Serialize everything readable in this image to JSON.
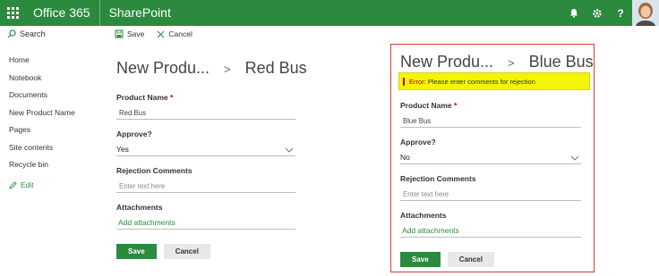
{
  "suite": {
    "app_name": "Office 365",
    "site_name": "SharePoint",
    "icons": [
      "waffle-icon",
      "bell-icon",
      "gear-icon",
      "help-icon"
    ],
    "help_label": "?"
  },
  "search": {
    "label": "Search"
  },
  "leftnav": {
    "items": [
      {
        "label": "Home"
      },
      {
        "label": "Notebook"
      },
      {
        "label": "Documents"
      },
      {
        "label": "New Product Name"
      },
      {
        "label": "Pages"
      },
      {
        "label": "Site contents"
      },
      {
        "label": "Recycle bin"
      }
    ],
    "edit_label": "Edit"
  },
  "cmdbar": {
    "save_label": "Save",
    "cancel_label": "Cancel"
  },
  "form_left": {
    "title_list": "New Produ...",
    "title_separator": ">",
    "title_item": "Red Bus",
    "product_name_label": "Product Name",
    "required_mark": "*",
    "product_name_value": "Red Bus",
    "approve_label": "Approve?",
    "approve_value": "Yes",
    "rejection_label": "Rejection Comments",
    "rejection_placeholder": "Enter text here",
    "attachments_label": "Attachments",
    "add_attachments": "Add attachments",
    "save_button": "Save",
    "cancel_button": "Cancel"
  },
  "form_right": {
    "title_list": "New Produ...",
    "title_separator": ">",
    "title_item": "Blue Bus",
    "error_label": "Error:",
    "error_text": "Please enter comments for rejection",
    "product_name_label": "Product Name",
    "required_mark": "*",
    "product_name_value": "Blue Bus",
    "approve_label": "Approve?",
    "approve_value": "No",
    "rejection_label": "Rejection Comments",
    "rejection_placeholder": "Enter text here",
    "attachments_label": "Attachments",
    "add_attachments": "Add attachments",
    "save_button": "Save",
    "cancel_button": "Cancel"
  },
  "colors": {
    "brand_green": "#2b8a3e",
    "error_highlight": "#f4f407",
    "error_border": "#d93b3b"
  }
}
